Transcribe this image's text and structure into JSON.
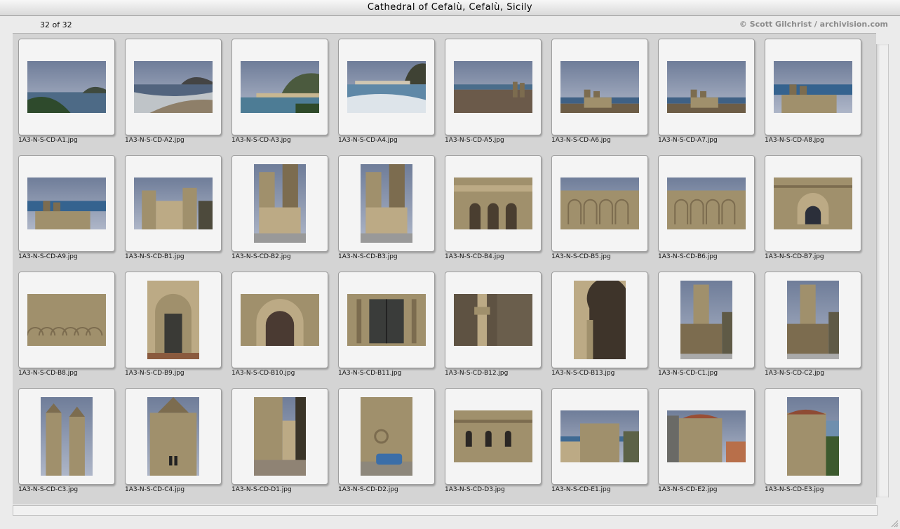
{
  "window": {
    "title": "Cathedral of Cefalù, Cefalù, Sicily"
  },
  "header": {
    "counter": "32 of 32",
    "credit": "© Scott Gilchrist / archivision.com"
  },
  "slides": [
    {
      "filename": "1A3-N-S-CD-A1.jpg",
      "orientation": "landscape",
      "scene": "coast-headland"
    },
    {
      "filename": "1A3-N-S-CD-A2.jpg",
      "orientation": "landscape",
      "scene": "beach-surf"
    },
    {
      "filename": "1A3-N-S-CD-A3.jpg",
      "orientation": "landscape",
      "scene": "rock-town"
    },
    {
      "filename": "1A3-N-S-CD-A4.jpg",
      "orientation": "landscape",
      "scene": "rock-town-waves"
    },
    {
      "filename": "1A3-N-S-CD-A5.jpg",
      "orientation": "landscape",
      "scene": "town-rooftops"
    },
    {
      "filename": "1A3-N-S-CD-A6.jpg",
      "orientation": "landscape",
      "scene": "cathedral-distant"
    },
    {
      "filename": "1A3-N-S-CD-A7.jpg",
      "orientation": "landscape",
      "scene": "cathedral-distant"
    },
    {
      "filename": "1A3-N-S-CD-A8.jpg",
      "orientation": "landscape",
      "scene": "cathedral-sea"
    },
    {
      "filename": "1A3-N-S-CD-A9.jpg",
      "orientation": "landscape",
      "scene": "cathedral-sea"
    },
    {
      "filename": "1A3-N-S-CD-B1.jpg",
      "orientation": "landscape",
      "scene": "cathedral-facade"
    },
    {
      "filename": "1A3-N-S-CD-B2.jpg",
      "orientation": "portrait",
      "scene": "tower-portico"
    },
    {
      "filename": "1A3-N-S-CD-B3.jpg",
      "orientation": "portrait",
      "scene": "tower-portico"
    },
    {
      "filename": "1A3-N-S-CD-B4.jpg",
      "orientation": "landscape",
      "scene": "portico-arches"
    },
    {
      "filename": "1A3-N-S-CD-B5.jpg",
      "orientation": "landscape",
      "scene": "blind-arcade"
    },
    {
      "filename": "1A3-N-S-CD-B6.jpg",
      "orientation": "landscape",
      "scene": "blind-arcade"
    },
    {
      "filename": "1A3-N-S-CD-B7.jpg",
      "orientation": "landscape",
      "scene": "arched-window"
    },
    {
      "filename": "1A3-N-S-CD-B8.jpg",
      "orientation": "landscape",
      "scene": "interlaced-arches"
    },
    {
      "filename": "1A3-N-S-CD-B9.jpg",
      "orientation": "portrait",
      "scene": "portal-door"
    },
    {
      "filename": "1A3-N-S-CD-B10.jpg",
      "orientation": "landscape",
      "scene": "portal-arch"
    },
    {
      "filename": "1A3-N-S-CD-B11.jpg",
      "orientation": "landscape",
      "scene": "bronze-door"
    },
    {
      "filename": "1A3-N-S-CD-B12.jpg",
      "orientation": "landscape",
      "scene": "capitals"
    },
    {
      "filename": "1A3-N-S-CD-B13.jpg",
      "orientation": "portrait",
      "scene": "interior-arch"
    },
    {
      "filename": "1A3-N-S-CD-C1.jpg",
      "orientation": "portrait",
      "scene": "tower-tall"
    },
    {
      "filename": "1A3-N-S-CD-C2.jpg",
      "orientation": "portrait",
      "scene": "tower-tall"
    },
    {
      "filename": "1A3-N-S-CD-C3.jpg",
      "orientation": "portrait",
      "scene": "twin-towers"
    },
    {
      "filename": "1A3-N-S-CD-C4.jpg",
      "orientation": "portrait",
      "scene": "tower-pyramid"
    },
    {
      "filename": "1A3-N-S-CD-D1.jpg",
      "orientation": "portrait",
      "scene": "alley"
    },
    {
      "filename": "1A3-N-S-CD-D2.jpg",
      "orientation": "portrait",
      "scene": "apse-wall-car"
    },
    {
      "filename": "1A3-N-S-CD-D3.jpg",
      "orientation": "landscape",
      "scene": "stone-wall-windows"
    },
    {
      "filename": "1A3-N-S-CD-E1.jpg",
      "orientation": "landscape",
      "scene": "apse-exterior"
    },
    {
      "filename": "1A3-N-S-CD-E2.jpg",
      "orientation": "landscape",
      "scene": "apse-scaffold"
    },
    {
      "filename": "1A3-N-S-CD-E3.jpg",
      "orientation": "portrait",
      "scene": "apse-hill"
    }
  ]
}
